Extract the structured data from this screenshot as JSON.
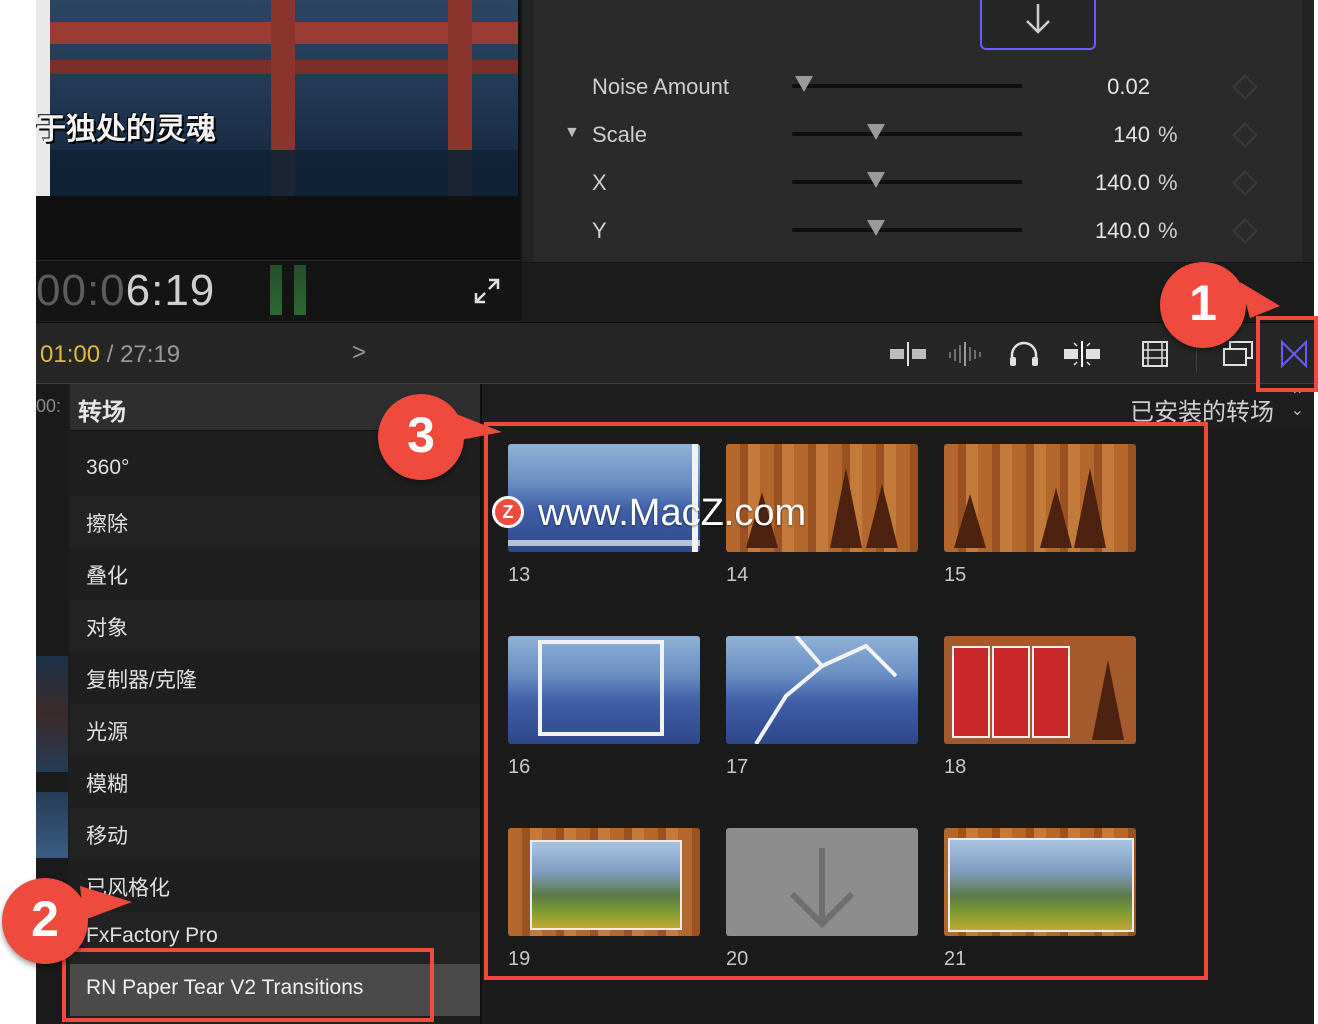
{
  "viewer": {
    "subtitle": "于独处的灵魂",
    "timecode_dim": "00:0",
    "timecode_bright": "6:19"
  },
  "inspector": {
    "params": [
      {
        "label": "Noise Amount",
        "value": "0.02",
        "unit": "",
        "expanded": false,
        "slider_fraction": 0.05
      },
      {
        "label": "Scale",
        "value": "140",
        "unit": "%",
        "expanded": true,
        "slider_fraction": 0.36
      },
      {
        "label": "X",
        "value": "140.0",
        "unit": "%",
        "expanded": false,
        "slider_fraction": 0.36
      },
      {
        "label": "Y",
        "value": "140.0",
        "unit": "%",
        "expanded": false,
        "slider_fraction": 0.36
      }
    ]
  },
  "toolbar": {
    "current_time": "01:00",
    "separator": " / ",
    "duration": "27:19",
    "chevron": ">",
    "icons": [
      "clip-split-icon",
      "audio-waveform-icon",
      "headphones-icon",
      "skimming-icon",
      "filmstrip-icon",
      "window-stack-icon",
      "transitions-browser-icon"
    ],
    "active_icon_color": "#6a5cff"
  },
  "browser": {
    "strip_label": "00:",
    "sidebar_title": "转场",
    "categories": [
      "360°",
      "擦除",
      "叠化",
      "对象",
      "复制器/克隆",
      "光源",
      "模糊",
      "移动",
      "已风格化",
      "FxFactory Pro",
      "RN Paper Tear V2 Transitions"
    ],
    "selected_category": "RN Paper Tear V2 Transitions",
    "installed_label": "已安装的转场",
    "sort_glyph": "⌃⌄",
    "thumbnails": [
      {
        "label": "13"
      },
      {
        "label": "14"
      },
      {
        "label": "15"
      },
      {
        "label": "16"
      },
      {
        "label": "17"
      },
      {
        "label": "18"
      },
      {
        "label": "19"
      },
      {
        "label": "20"
      },
      {
        "label": "21"
      }
    ]
  },
  "annotations": {
    "badges": [
      "1",
      "2",
      "3"
    ],
    "color": "#ee4a3e"
  },
  "watermark": {
    "logo": "Z",
    "text": "www.MacZ.com"
  }
}
